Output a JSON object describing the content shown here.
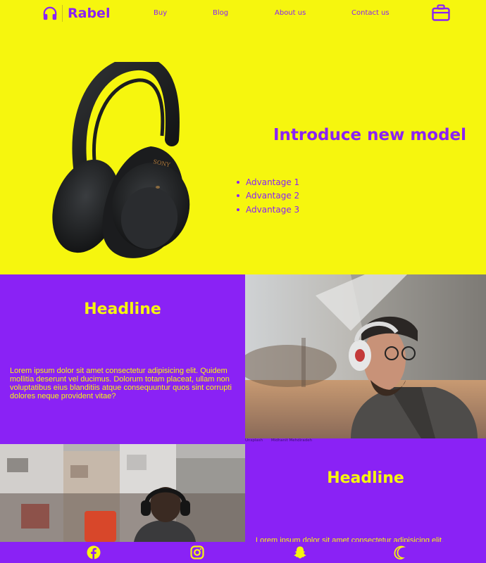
{
  "brand": {
    "name": "Rabel",
    "color_primary": "#8a22f5",
    "color_accent": "#f6f60e"
  },
  "nav": {
    "links": [
      {
        "label": "Buy"
      },
      {
        "label": "Blog"
      },
      {
        "label": "About us"
      },
      {
        "label": "Contact us"
      }
    ],
    "cart_icon": "briefcase-icon"
  },
  "hero": {
    "title": "Introduce new model",
    "advantages": [
      "Advantage 1",
      "Advantage 2",
      "Advantage 3"
    ],
    "product_brand": "SONY"
  },
  "section1": {
    "headline": "Headline",
    "body": "Lorem ipsum dolor sit amet consectetur adipisicing elit. Quidem mollitia deserunt vel ducimus. Dolorum totam placeat, ullam non voluptatibus eius blanditiis atque consequuntur quos sint corrupti dolores neque provident vitae?",
    "photo_credit_source": "Unsplash",
    "photo_credit_author": "Midhanit Mehdiradeh"
  },
  "section2": {
    "headline": "Headline",
    "body": "Lorem ipsum dolor sit amet consectetur adipisicing elit."
  },
  "footer": {
    "icons": [
      "facebook-icon",
      "instagram-icon",
      "snapchat-icon",
      "moon-icon"
    ]
  }
}
